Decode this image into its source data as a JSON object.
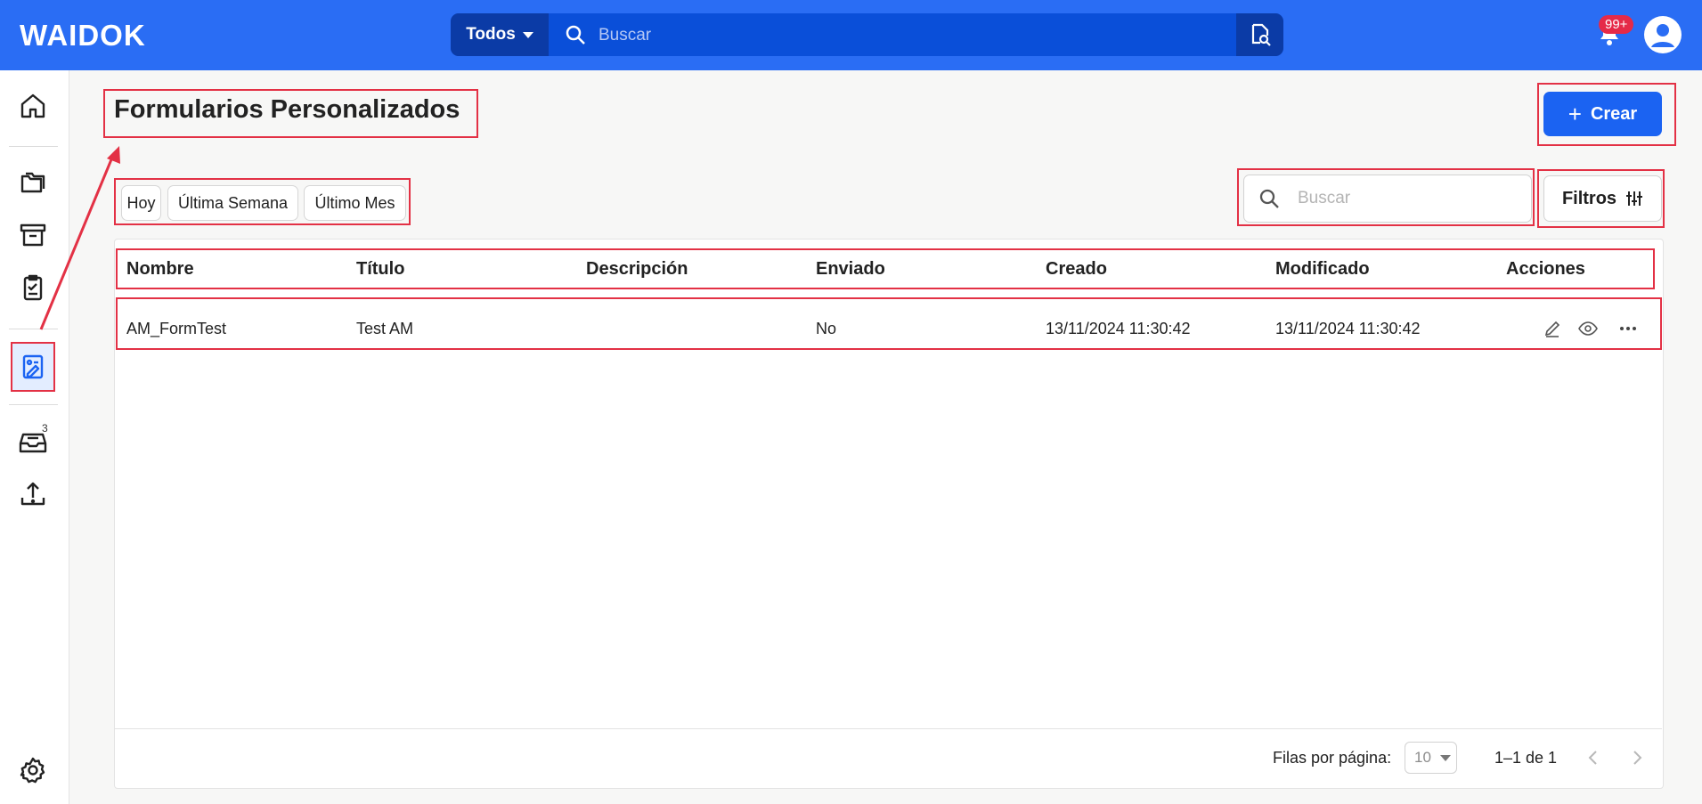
{
  "app": {
    "logo_text": "WAIDOK",
    "accent": "#2a6df4",
    "highlight": "#e33145"
  },
  "topbar": {
    "scope_label": "Todos",
    "search_placeholder": "Buscar",
    "notification_count": "99+"
  },
  "sidebar": {
    "items": [
      {
        "name": "home",
        "icon": "home-icon"
      },
      {
        "name": "folders",
        "icon": "folders-icon"
      },
      {
        "name": "archive",
        "icon": "archive-icon"
      },
      {
        "name": "tasks",
        "icon": "clipboard-check-icon"
      },
      {
        "name": "custom-forms",
        "icon": "form-edit-icon",
        "active": true
      },
      {
        "name": "inbox",
        "icon": "inbox-icon",
        "count": "3"
      },
      {
        "name": "upload",
        "icon": "upload-icon"
      },
      {
        "name": "settings",
        "icon": "gear-icon"
      }
    ]
  },
  "page": {
    "title": "Formularios Personalizados",
    "create_label": "Crear",
    "date_filters": [
      "Hoy",
      "Última Semana",
      "Último Mes"
    ],
    "search_placeholder": "Buscar",
    "filters_label": "Filtros"
  },
  "table": {
    "columns": [
      "Nombre",
      "Título",
      "Descripción",
      "Enviado",
      "Creado",
      "Modificado",
      "Acciones"
    ],
    "rows": [
      {
        "nombre": "AM_FormTest",
        "titulo": "Test AM",
        "descripcion": "",
        "enviado": "No",
        "creado": "13/11/2024 11:30:42",
        "modificado": "13/11/2024 11:30:42",
        "actions": [
          "edit-icon",
          "view-icon",
          "more-icon"
        ]
      }
    ]
  },
  "pagination": {
    "rows_per_page_label": "Filas por página:",
    "rows_per_page": "10",
    "range": "1–1 de 1"
  }
}
